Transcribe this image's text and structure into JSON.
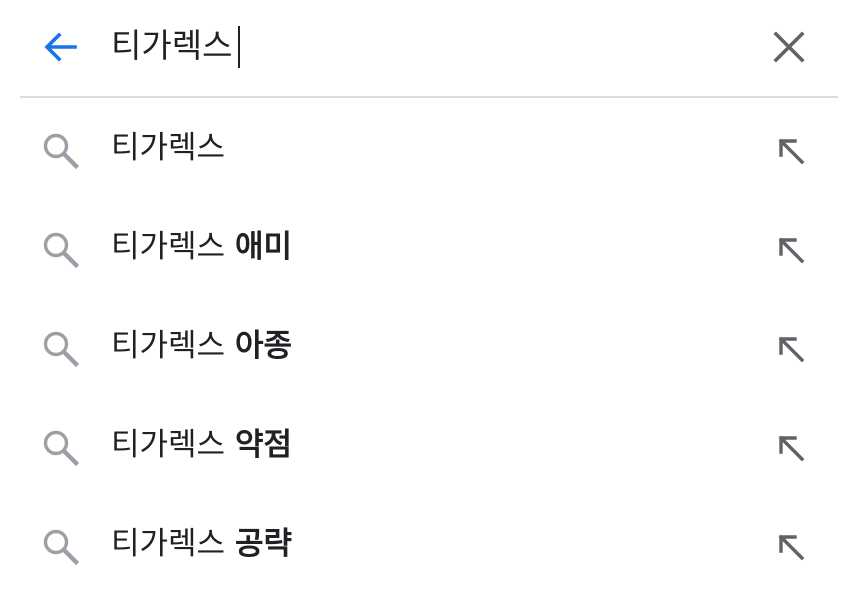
{
  "search": {
    "query": "티가렉스",
    "back_icon": "arrow-left-icon",
    "clear_icon": "close-icon",
    "accent_color": "#1a73e8"
  },
  "suggestions": [
    {
      "base": "티가렉스",
      "suffix": ""
    },
    {
      "base": "티가렉스",
      "suffix": "애미"
    },
    {
      "base": "티가렉스",
      "suffix": "아종"
    },
    {
      "base": "티가렉스",
      "suffix": "약점"
    },
    {
      "base": "티가렉스",
      "suffix": "공략"
    }
  ],
  "icons": {
    "suggestion_leading": "search-icon",
    "suggestion_trailing": "arrow-up-left-icon"
  }
}
